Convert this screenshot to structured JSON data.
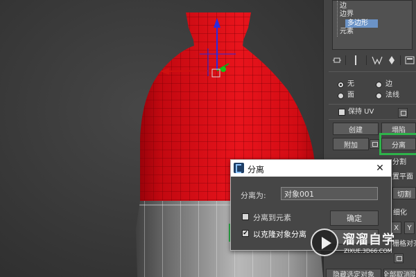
{
  "modifier_tree": {
    "items": [
      "边",
      "边界",
      "多边形",
      "元素"
    ],
    "selected_index": 2
  },
  "toolbar": {
    "icons": [
      "pin-stack-icon",
      "modifier-bar-icon",
      "show-end-result-icon",
      "make-unique-icon",
      "remove-modifier-icon",
      "configure-sets-icon"
    ]
  },
  "selection_options": {
    "radio_none": "无",
    "radio_edge": "边",
    "radio_face": "面",
    "radio_normal": "法线",
    "selected": "无"
  },
  "keep_uv": {
    "label": "保持 UV",
    "checked": false
  },
  "edit_geometry": {
    "create_label": "创建",
    "collapse_label": "塌陷",
    "attach_label": "附加",
    "detach_label": "分离",
    "split_label": "分割",
    "reset_plane_label": "重置平面",
    "slice_label": "切割",
    "refine_label": "细化",
    "x_label": "X",
    "y_label": "Y",
    "plane_align_label": "栅格对齐",
    "hide_selected_label": "隐藏选定对象",
    "unhide_all_label": "全部取消隐"
  },
  "detach_dialog": {
    "title": "分离",
    "name_label": "分离为:",
    "name_value": "对象001",
    "detach_to_element_label": "分离到元素",
    "detach_to_element_checked": false,
    "detach_as_clone_label": "以克隆对象分离",
    "detach_as_clone_checked": true,
    "ok_label": "确定",
    "close_icon": "close-icon"
  },
  "watermark": {
    "text": "溜溜自学",
    "url": "ZIXUE.3D66.COM"
  },
  "colors": {
    "selection_red": "#e8141c",
    "highlight_green": "#2eb34a",
    "tree_selected": "#6b93c7"
  }
}
